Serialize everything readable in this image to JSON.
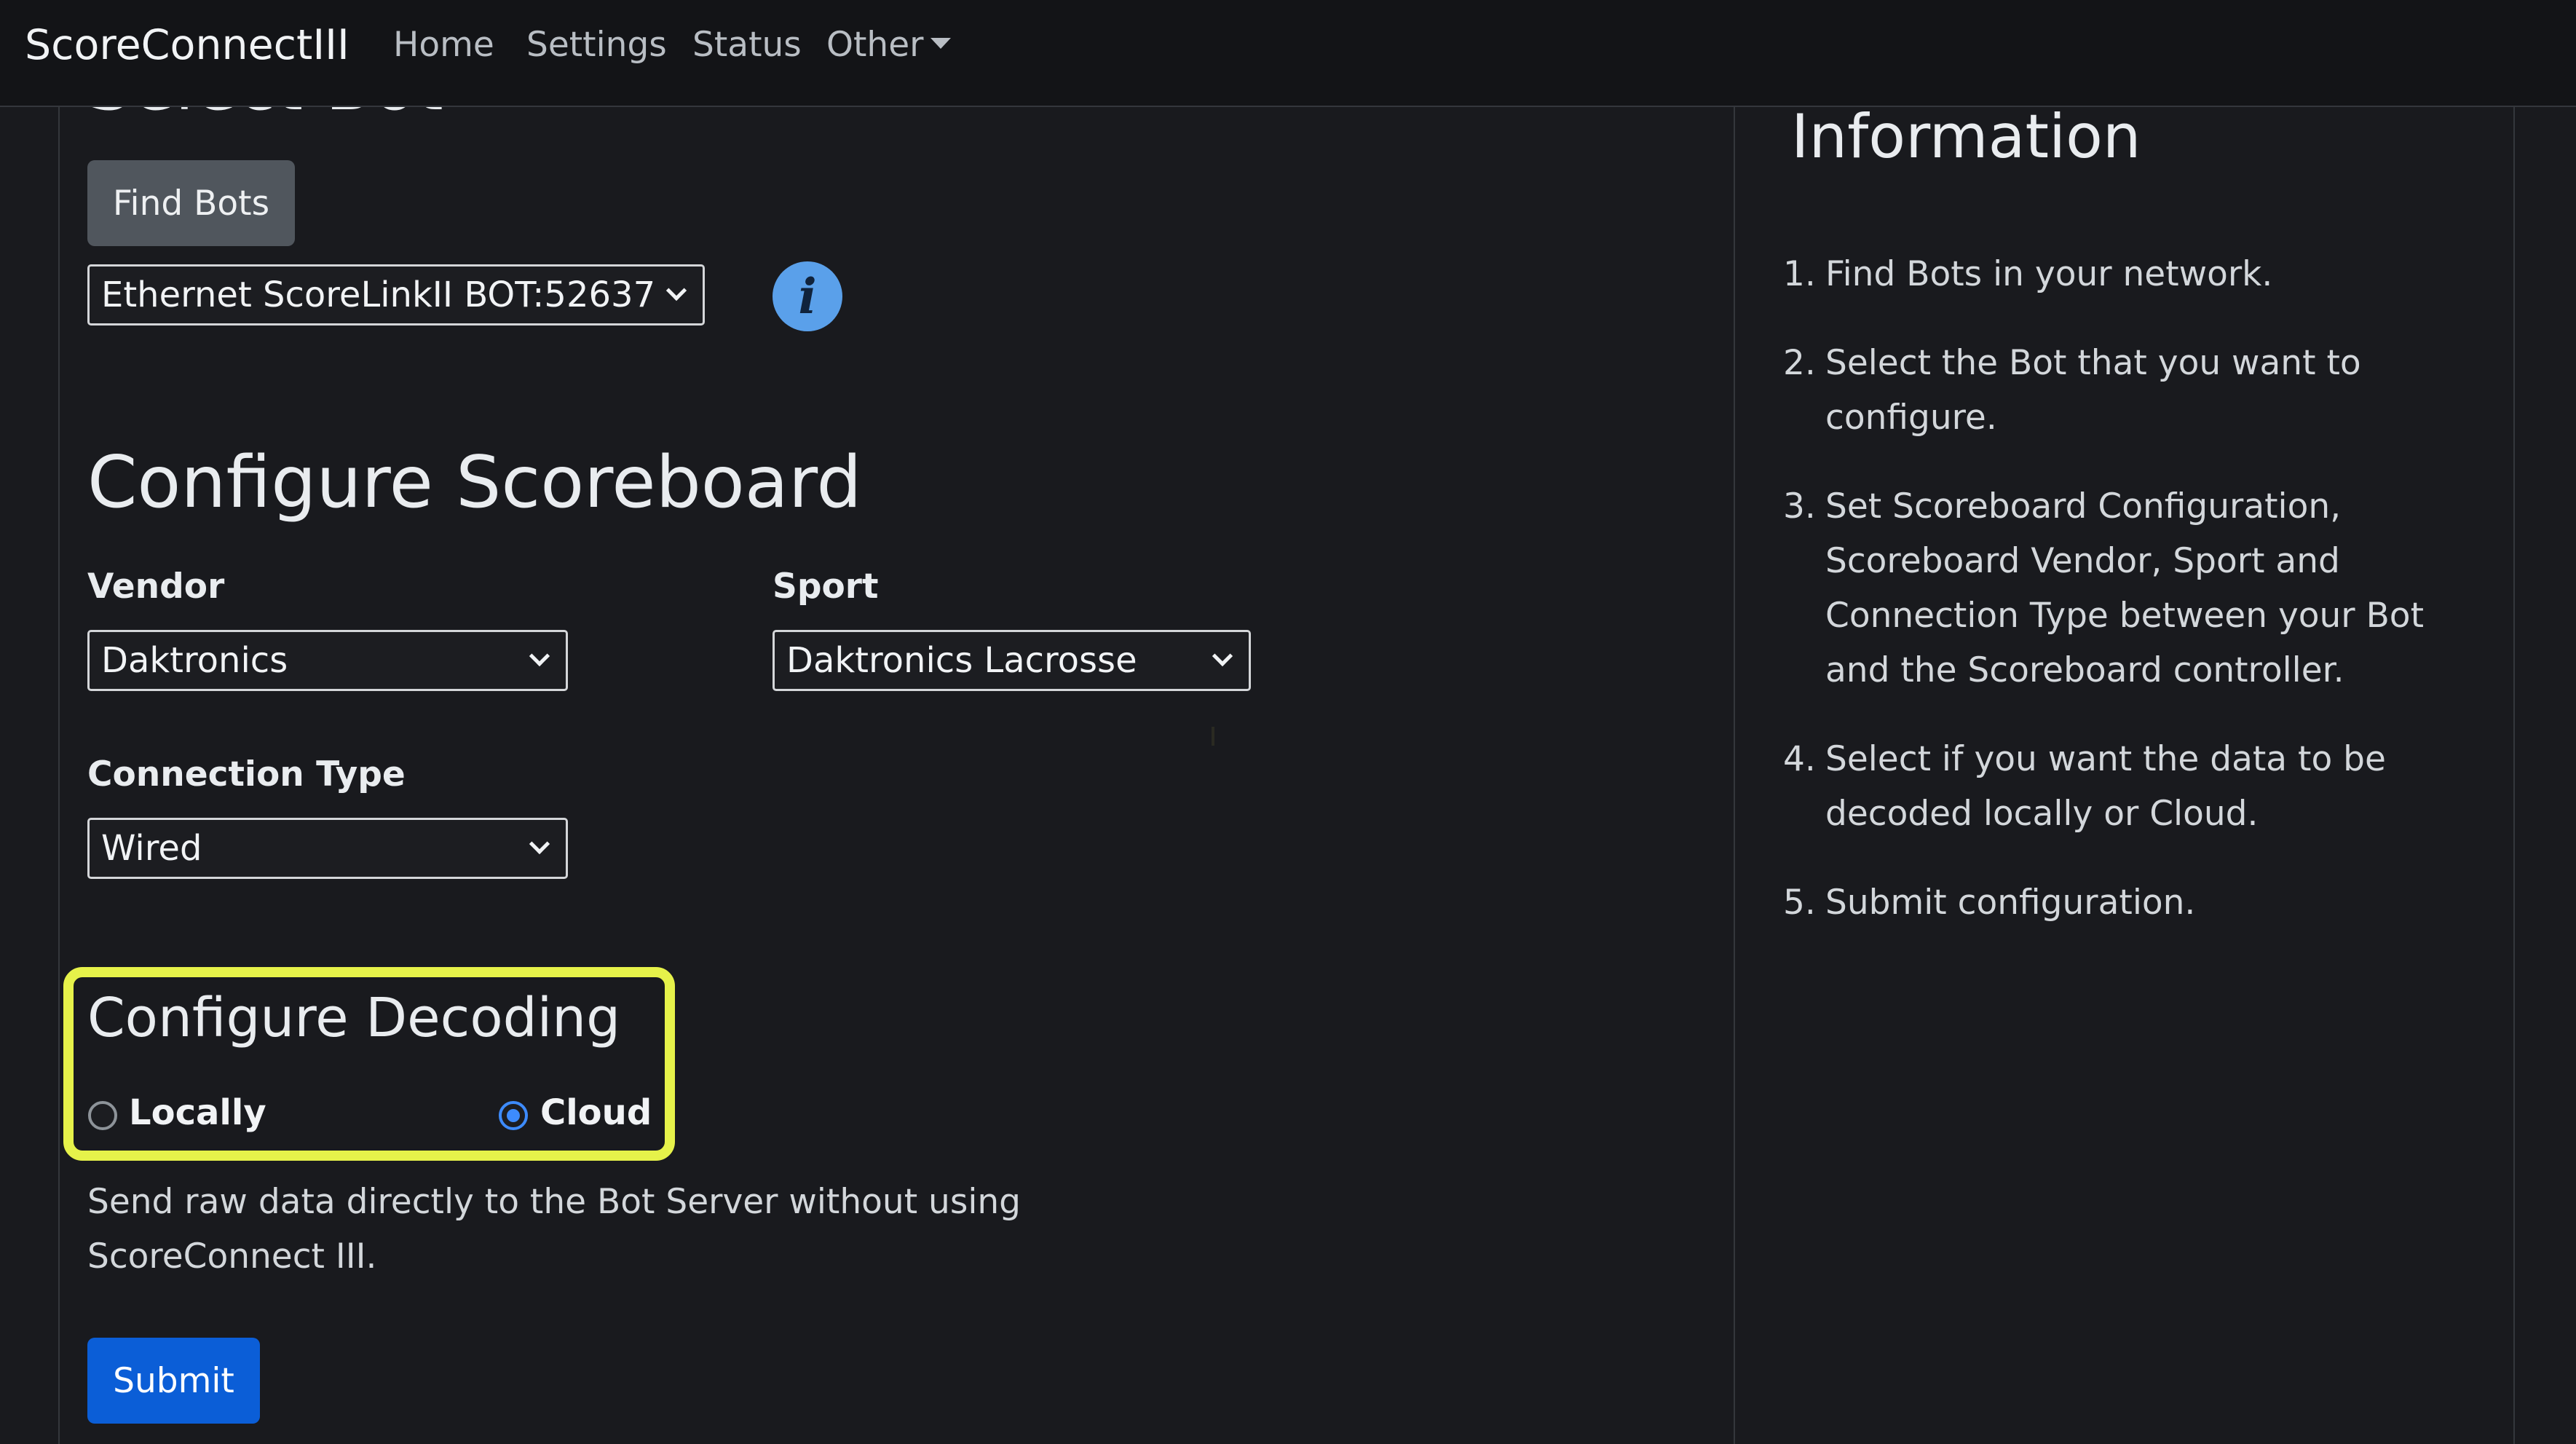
{
  "navbar": {
    "brand": "ScoreConnectIII",
    "links": {
      "home": "Home",
      "settings": "Settings",
      "status": "Status",
      "other": "Other"
    }
  },
  "select_bot": {
    "heading": "Select Bot",
    "find_button": "Find Bots",
    "selected_bot": "Ethernet ScoreLinkII BOT:52637",
    "info_icon_glyph": "i"
  },
  "configure_scoreboard": {
    "heading": "Configure Scoreboard",
    "vendor_label": "Vendor",
    "vendor_value": "Daktronics",
    "sport_label": "Sport",
    "sport_value": "Daktronics Lacrosse",
    "connection_label": "Connection Type",
    "connection_value": "Wired"
  },
  "configure_decoding": {
    "heading": "Configure Decoding",
    "option_locally": "Locally",
    "option_cloud": "Cloud",
    "selected": "Cloud",
    "description": "Send raw data directly to the Bot Server without using ScoreConnect III.",
    "highlight_color": "#e6f24a"
  },
  "submit_button": "Submit",
  "information": {
    "heading": "Information",
    "steps": [
      {
        "num": "1.",
        "text": "Find Bots in your network."
      },
      {
        "num": "2.",
        "text": "Select the Bot that you want to configure."
      },
      {
        "num": "3.",
        "text": "Set Scoreboard Configuration, Scoreboard Vendor, Sport and Connection Type between your Bot and the Scoreboard controller."
      },
      {
        "num": "4.",
        "text": "Select if you want the data to be decoded locally or Cloud."
      },
      {
        "num": "5.",
        "text": "Submit configuration."
      }
    ]
  },
  "colors": {
    "background": "#191a1e",
    "navbar": "#131417",
    "primary_button": "#0b5ed7",
    "secondary_button": "#50565d",
    "info_icon": "#5aa0ea",
    "radio_checked": "#3d8bfd"
  }
}
